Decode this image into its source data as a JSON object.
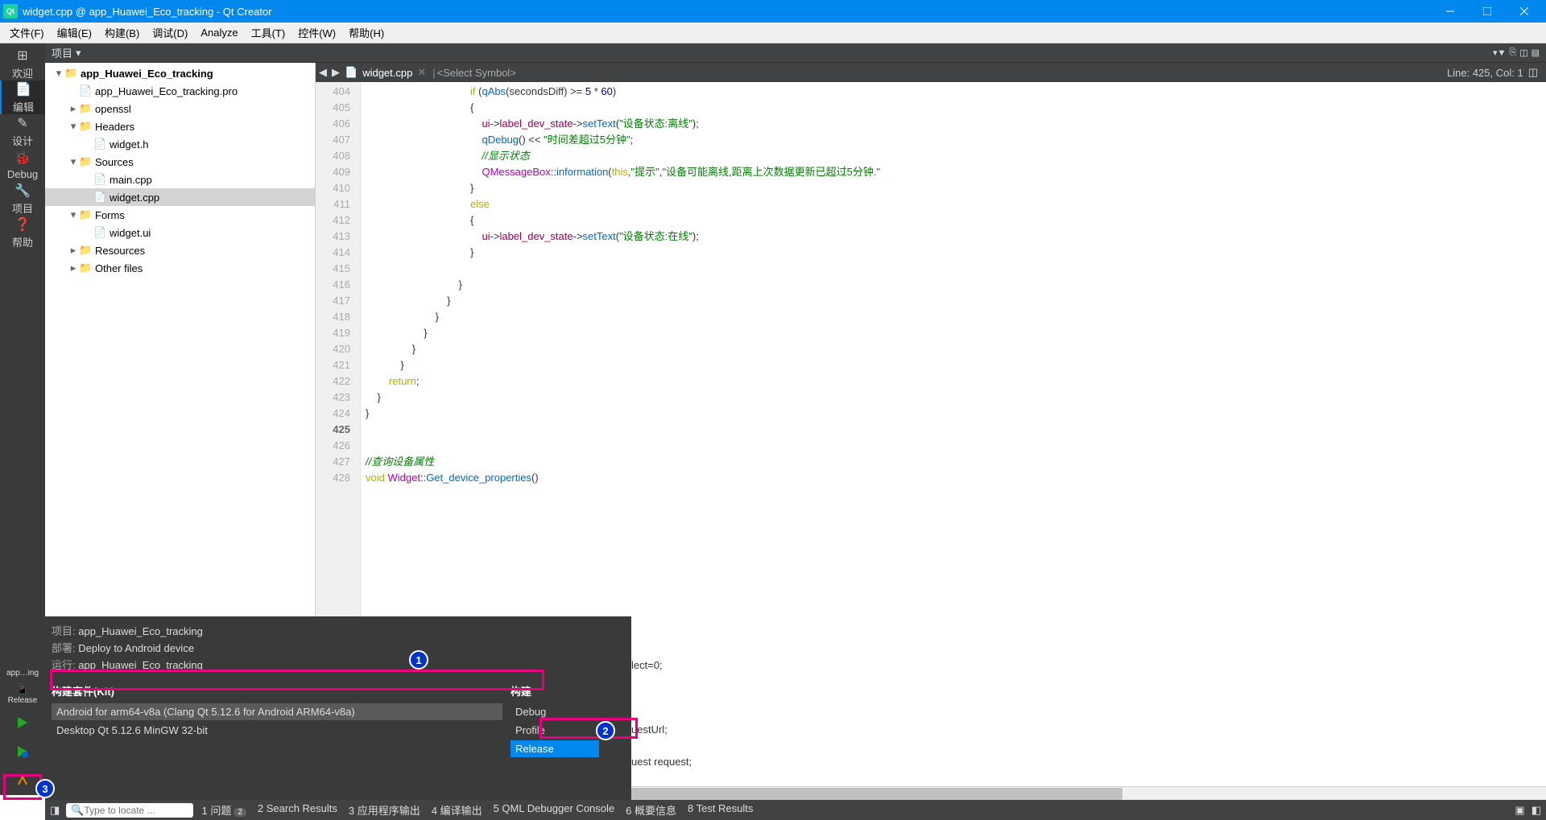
{
  "title": "widget.cpp @ app_Huawei_Eco_tracking - Qt Creator",
  "menu": [
    "文件(F)",
    "编辑(E)",
    "构建(B)",
    "调试(D)",
    "Analyze",
    "工具(T)",
    "控件(W)",
    "帮助(H)"
  ],
  "leftbar": {
    "items": [
      {
        "label": "欢迎",
        "icon": "⊞"
      },
      {
        "label": "编辑",
        "icon": "📄",
        "active": true
      },
      {
        "label": "设计",
        "icon": "✎"
      },
      {
        "label": "Debug",
        "icon": "🐞"
      },
      {
        "label": "项目",
        "icon": "🔧"
      },
      {
        "label": "帮助",
        "icon": "❓"
      }
    ],
    "mode_top": "app…ing",
    "mode_bottom": "Release"
  },
  "proj_header": "项目",
  "tree": [
    {
      "indent": 0,
      "arrow": "▾",
      "icon": "📁",
      "label": "app_Huawei_Eco_tracking",
      "bold": true
    },
    {
      "indent": 1,
      "arrow": "",
      "icon": "📄",
      "label": "app_Huawei_Eco_tracking.pro"
    },
    {
      "indent": 1,
      "arrow": "▸",
      "icon": "📁",
      "label": "openssl"
    },
    {
      "indent": 1,
      "arrow": "▾",
      "icon": "📁",
      "label": "Headers"
    },
    {
      "indent": 2,
      "arrow": "",
      "icon": "📄",
      "label": "widget.h"
    },
    {
      "indent": 1,
      "arrow": "▾",
      "icon": "📁",
      "label": "Sources"
    },
    {
      "indent": 2,
      "arrow": "",
      "icon": "📄",
      "label": "main.cpp"
    },
    {
      "indent": 2,
      "arrow": "",
      "icon": "📄",
      "label": "widget.cpp",
      "selected": true
    },
    {
      "indent": 1,
      "arrow": "▾",
      "icon": "📁",
      "label": "Forms"
    },
    {
      "indent": 2,
      "arrow": "",
      "icon": "📄",
      "label": "widget.ui"
    },
    {
      "indent": 1,
      "arrow": "▸",
      "icon": "📁",
      "label": "Resources"
    },
    {
      "indent": 1,
      "arrow": "▸",
      "icon": "📁",
      "label": "Other files"
    }
  ],
  "editor": {
    "file": "widget.cpp",
    "symbol": "<Select Symbol>",
    "pos": "Line: 425, Col: 1",
    "current_line": 425,
    "lines": [
      {
        "n": 404,
        "html": "                                    <span class='kw'>if</span> (<span class='fn'>qAbs</span>(secondsDiff) &gt;= <span class='num'>5</span> * <span class='num'>60</span>)"
      },
      {
        "n": 405,
        "html": "                                    {"
      },
      {
        "n": 406,
        "html": "                                        <span class='mem'>ui</span>-&gt;<span class='mem'>label_dev_state</span>-&gt;<span class='fn'>setText</span>(<span class='str'>\"设备状态:离线\"</span>);"
      },
      {
        "n": 407,
        "html": "                                        <span class='fn'>qDebug</span>() &lt;&lt; <span class='str'>\"时间差超过5分钟\"</span>;"
      },
      {
        "n": 408,
        "html": "                                        <span class='cmt'>//显示状态</span>"
      },
      {
        "n": 409,
        "html": "                                        <span class='cls'>QMessageBox</span>::<span class='fn'>information</span>(<span class='kw'>this</span>,<span class='str'>\"提示\"</span>,<span class='str'>\"设备可能离线,距离上次数据更新已超过5分钟.\"</span>"
      },
      {
        "n": 410,
        "html": "                                    }"
      },
      {
        "n": 411,
        "html": "                                    <span class='kw'>else</span>"
      },
      {
        "n": 412,
        "html": "                                    {"
      },
      {
        "n": 413,
        "html": "                                        <span class='mem'>ui</span>-&gt;<span class='mem'>label_dev_state</span>-&gt;<span class='fn'>setText</span>(<span class='str'>\"设备状态:在线\"</span>);"
      },
      {
        "n": 414,
        "html": "                                    }"
      },
      {
        "n": 415,
        "html": ""
      },
      {
        "n": 416,
        "html": "                                }"
      },
      {
        "n": 417,
        "html": "                            }"
      },
      {
        "n": 418,
        "html": "                        }"
      },
      {
        "n": 419,
        "html": "                    }"
      },
      {
        "n": 420,
        "html": "                }"
      },
      {
        "n": 421,
        "html": "            }"
      },
      {
        "n": 422,
        "html": "        <span class='kw'>return</span>;"
      },
      {
        "n": 423,
        "html": "    }"
      },
      {
        "n": 424,
        "html": "}"
      },
      {
        "n": 425,
        "html": ""
      },
      {
        "n": 426,
        "html": ""
      },
      {
        "n": 427,
        "html": "<span class='cmt'>//查询设备属性</span>"
      },
      {
        "n": 428,
        "html": "<span class='kw'>void</span> <span class='cls'>Widget</span>::<span class='fn'>Get_device_properties</span>()"
      }
    ]
  },
  "kit": {
    "info": [
      {
        "label": "项目: ",
        "value": "app_Huawei_Eco_tracking"
      },
      {
        "label": "部署: ",
        "value": "Deploy to Android device"
      },
      {
        "label": "运行: ",
        "value": "app_Huawei_Eco_tracking"
      }
    ],
    "col1_head": "构建套件(Kit)",
    "col2_head": "构建",
    "kits": [
      {
        "label": "Android for arm64-v8a (Clang Qt 5.12.6 for Android ARM64-v8a)",
        "sel": true
      },
      {
        "label": "Desktop Qt 5.12.6 MinGW 32-bit"
      }
    ],
    "builds": [
      "Debug",
      "Profile",
      "Release"
    ]
  },
  "footer": {
    "locator_placeholder": "Type to locate ...",
    "items": [
      {
        "label": "1 问题",
        "badge": "2"
      },
      {
        "label": "2 Search Results"
      },
      {
        "label": "3 应用程序输出"
      },
      {
        "label": "4 编译输出"
      },
      {
        "label": "5 QML Debugger Console"
      },
      {
        "label": "6 概要信息"
      },
      {
        "label": "8 Test Results"
      }
    ]
  },
  "obscured": {
    "row2": "lect=0;",
    "row3": "uestUrl;",
    "row4": "uest request;"
  }
}
